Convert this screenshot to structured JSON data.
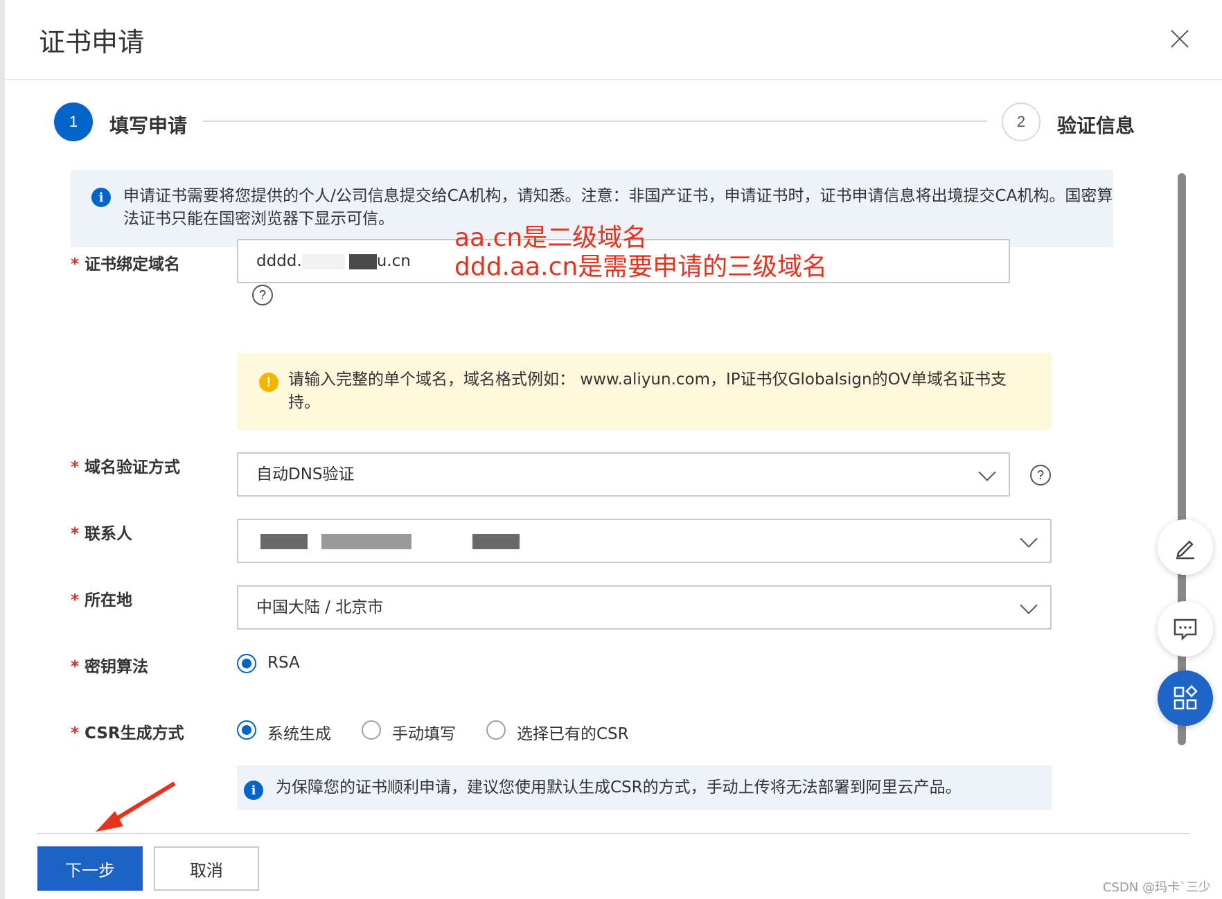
{
  "dialog": {
    "title": "证书申请",
    "close_icon": "close-icon"
  },
  "steps": [
    {
      "number": "1",
      "label": "填写申请",
      "active": true
    },
    {
      "number": "2",
      "label": "验证信息",
      "active": false
    }
  ],
  "notice": {
    "text": "申请证书需要将您提供的个人/公司信息提交给CA机构，请知悉。注意：非国产证书，申请证书时，证书申请信息将出境提交CA机构。国密算法证书只能在国密浏览器下显示可信。"
  },
  "form": {
    "domain": {
      "label": "证书绑定域名",
      "value_prefix": "dddd.",
      "value_suffix": "u.cn",
      "warning": "请输入完整的单个域名，域名格式例如： www.aliyun.com，IP证书仅Globalsign的OV单域名证书支持。"
    },
    "verify_method": {
      "label": "域名验证方式",
      "value": "自动DNS验证"
    },
    "contact": {
      "label": "联系人",
      "value": ""
    },
    "location": {
      "label": "所在地",
      "value": "中国大陆 / 北京市"
    },
    "key_algorithm": {
      "label": "密钥算法",
      "options": [
        {
          "label": "RSA",
          "selected": true
        }
      ]
    },
    "csr_method": {
      "label": "CSR生成方式",
      "options": [
        {
          "label": "系统生成",
          "selected": true
        },
        {
          "label": "手动填写",
          "selected": false
        },
        {
          "label": "选择已有的CSR",
          "selected": false
        }
      ],
      "info": "为保障您的证书顺利申请，建议您使用默认生成CSR的方式，手动上传将无法部署到阿里云产品。"
    }
  },
  "annotation": {
    "line1": "aa.cn是二级域名",
    "line2": "ddd.aa.cn是需要申请的三级域名"
  },
  "footer": {
    "next_label": "下一步",
    "cancel_label": "取消"
  },
  "watermark": "CSDN @玛卡`三少",
  "colors": {
    "primary": "#0064c8",
    "annotation_red": "#e8321e",
    "warn_bg": "#fdf7dc",
    "info_bg": "#eef3f9"
  }
}
